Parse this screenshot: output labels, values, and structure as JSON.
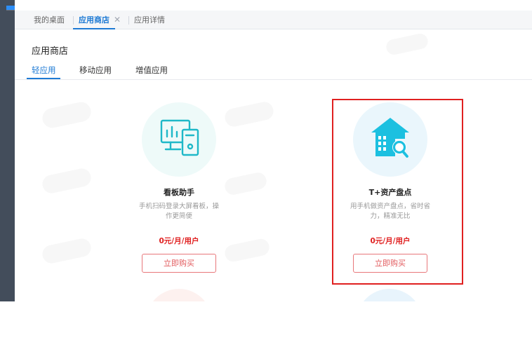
{
  "tabs": {
    "items": [
      {
        "label": "我的桌面"
      },
      {
        "label": "应用商店"
      },
      {
        "label": "应用详情"
      }
    ],
    "close_glyph": "✕"
  },
  "page": {
    "title": "应用商店",
    "subtabs": [
      {
        "label": "轻应用"
      },
      {
        "label": "移动应用"
      },
      {
        "label": "增值应用"
      }
    ]
  },
  "cards": [
    {
      "title": "看板助手",
      "desc_line1": "手机扫码登录大屏看板，操",
      "desc_line2": "作更简便",
      "price": "0元/月/用户",
      "button": "立即购买",
      "icon": "dashboard-monitor-icon",
      "icon_color": "#1fb8c8"
    },
    {
      "title": "T+资产盘点",
      "desc_line1": "用手机做资产盘点，省时省",
      "desc_line2": "力，精准无比",
      "price": "0元/月/用户",
      "button": "立即购买",
      "icon": "asset-house-search-icon",
      "icon_color": "#1cc0e0"
    }
  ],
  "colors": {
    "accent": "#1e7ad4",
    "price": "#e02020",
    "highlight": "#e02020",
    "sidebar": "#434d5b"
  }
}
